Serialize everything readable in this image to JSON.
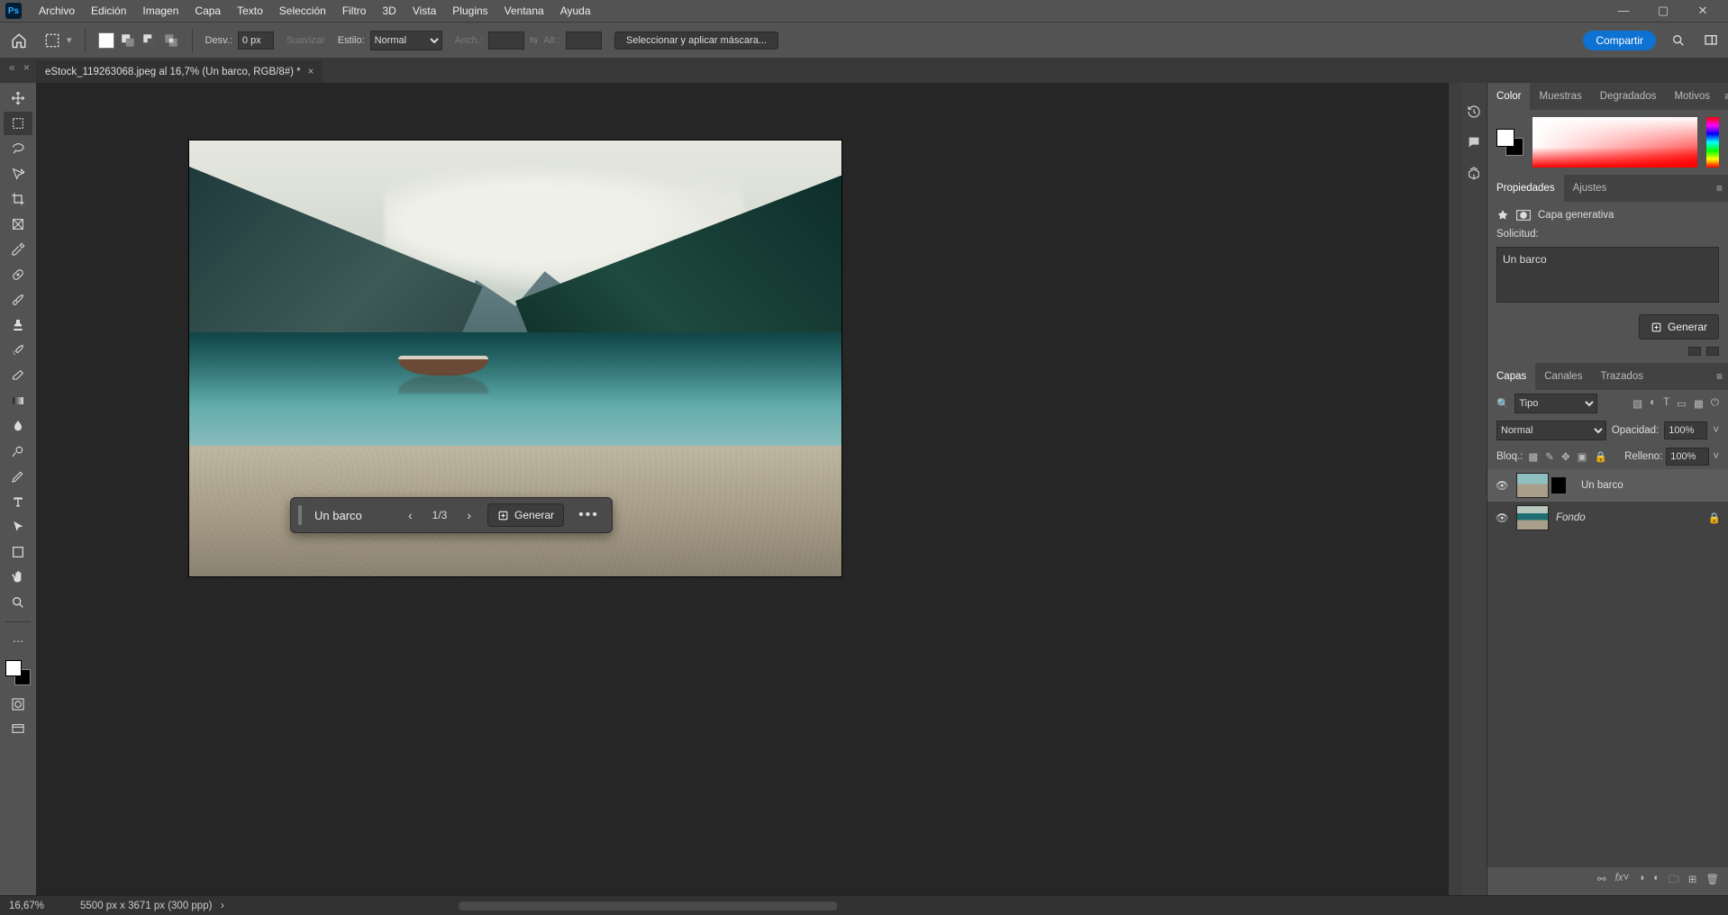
{
  "menu": [
    "Archivo",
    "Edición",
    "Imagen",
    "Capa",
    "Texto",
    "Selección",
    "Filtro",
    "3D",
    "Vista",
    "Plugins",
    "Ventana",
    "Ayuda"
  ],
  "window_buttons": [
    "min",
    "max",
    "close"
  ],
  "optionsbar": {
    "desv_label": "Desv.:",
    "desv_value": "0 px",
    "suavizar": "Suavizar",
    "estilo_label": "Estilo:",
    "estilo_value": "Normal",
    "anch_label": "Anch.:",
    "alt_label": "Alt.:",
    "mask_button": "Seleccionar y aplicar máscara...",
    "share": "Compartir"
  },
  "tab": {
    "title": "eStock_119263068.jpeg al 16,7% (Un barco, RGB/8#) *"
  },
  "genfill_bar": {
    "prompt": "Un barco",
    "counter": "1/3",
    "button": "Generar"
  },
  "color_panel": {
    "tabs": [
      "Color",
      "Muestras",
      "Degradados",
      "Motivos"
    ]
  },
  "properties_panel": {
    "tabs": [
      "Propiedades",
      "Ajustes"
    ],
    "type_label": "Capa generativa",
    "prompt_label": "Solicitud:",
    "prompt_value": "Un barco",
    "button": "Generar"
  },
  "layers_panel": {
    "tabs": [
      "Capas",
      "Canales",
      "Trazados"
    ],
    "filter_kind": "Tipo",
    "blend_mode": "Normal",
    "opacity_label": "Opacidad:",
    "opacity_value": "100%",
    "lock_label": "Bloq.:",
    "fill_label": "Relleno:",
    "fill_value": "100%",
    "layers": [
      {
        "name": "Un barco",
        "locked": false,
        "selected": true
      },
      {
        "name": "Fondo",
        "locked": true,
        "selected": false,
        "italic": true
      }
    ]
  },
  "statusbar": {
    "zoom": "16,67%",
    "docinfo": "5500 px x 3671 px (300 ppp)"
  }
}
